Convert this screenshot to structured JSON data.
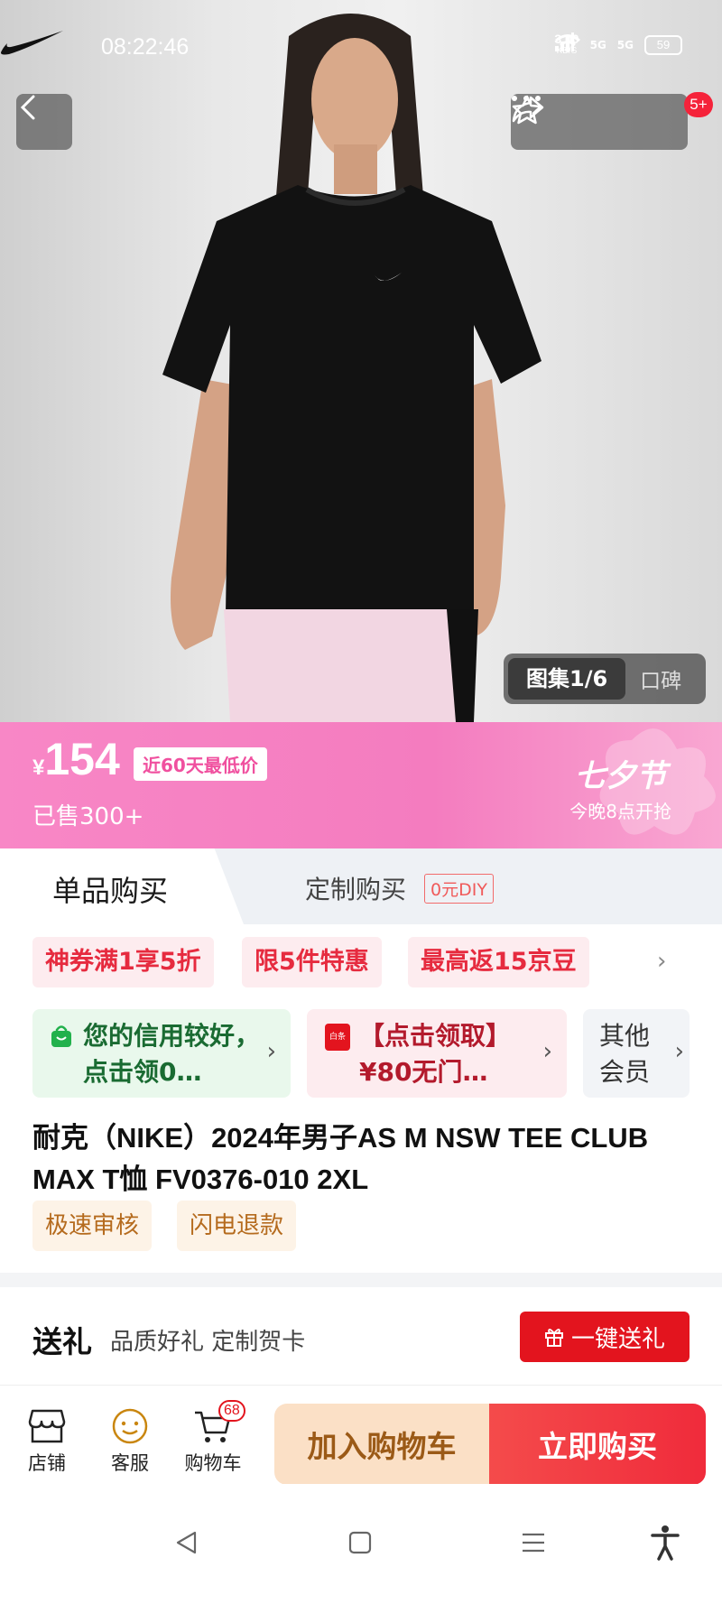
{
  "status_bar": {
    "time": "08:22:46",
    "net_speed_value": "3.00",
    "net_speed_unit": "KB/S",
    "signal1": "5G",
    "signal2": "5G",
    "battery": "59"
  },
  "header": {
    "message_badge": "5+"
  },
  "gallery": {
    "label": "图集1/6",
    "review_label": "口碑"
  },
  "price_banner": {
    "currency": "¥",
    "price": "154",
    "lowest_badge": "近60天最低价",
    "sold": "已售300+",
    "festival_title": "七夕节",
    "festival_sub": "今晚8点开抢"
  },
  "tabs": {
    "single": "单品购买",
    "custom": "定制购买",
    "custom_tag": "0元DIY"
  },
  "promotions": {
    "tags": [
      "神券满1享5折",
      "限5件特惠",
      "最高返15京豆"
    ],
    "more_icon": "chevron-right-icon",
    "cards": {
      "credit": "您的信用较好，点击领0…",
      "coupon_icon_text": "白条",
      "coupon": "【点击领取】¥80无门…",
      "member": "其他会员"
    }
  },
  "product": {
    "title": "耐克（NIKE）2024年男子AS M NSW TEE CLUB MAX T恤 FV0376-010 2XL",
    "service_tags": [
      "极速审核",
      "闪电退款"
    ]
  },
  "gift": {
    "title": "送礼",
    "subtitle": "品质好礼 定制贺卡",
    "button": "一键送礼"
  },
  "bottom_bar": {
    "store": "店铺",
    "service": "客服",
    "cart": "购物车",
    "cart_count": "68",
    "add_to_cart": "加入购物车",
    "buy_now": "立即购买"
  },
  "colors": {
    "brand_red": "#e3141e",
    "festival_pink": "#f47cbf",
    "cart_button_bg": "#fbe0c6"
  }
}
